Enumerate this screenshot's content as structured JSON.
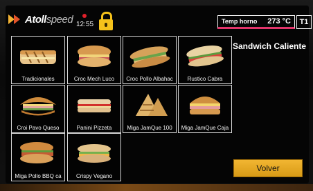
{
  "header": {
    "logo_primary": "Atoll",
    "logo_secondary": "speed",
    "clock": "12:55",
    "lock_icon": "lock-icon",
    "temp_label": "Temp horno",
    "temp_value": "273 °C",
    "tray_label": "T1"
  },
  "category_title": "Sandwich Caliente",
  "products": [
    {
      "label": "Tradicionales",
      "icon": "panini-icon"
    },
    {
      "label": "Croc Mech Luco",
      "icon": "croque-icon"
    },
    {
      "label": "Croc Pollo Albahac",
      "icon": "baguette-icon"
    },
    {
      "label": "Rustico Cabra",
      "icon": "rustic-sandwich-icon"
    },
    {
      "label": "Croi Pavo Queso",
      "icon": "croissant-icon"
    },
    {
      "label": "Panini Pizzeta",
      "icon": "panini-pizza-icon"
    },
    {
      "label": "Miga JamQue 100",
      "icon": "toast-triangle-icon"
    },
    {
      "label": "Miga JamQue Caja",
      "icon": "burger-bun-icon"
    },
    {
      "label": "Miga Pollo BBQ ca",
      "icon": "chicken-sandwich-icon"
    },
    {
      "label": "Crispy Vegano",
      "icon": "vegan-sandwich-icon"
    }
  ],
  "actions": {
    "back_label": "Volver"
  },
  "colors": {
    "accent": "#f5c21b",
    "temp_underline": "#e2346a",
    "button": "#f2b632"
  }
}
